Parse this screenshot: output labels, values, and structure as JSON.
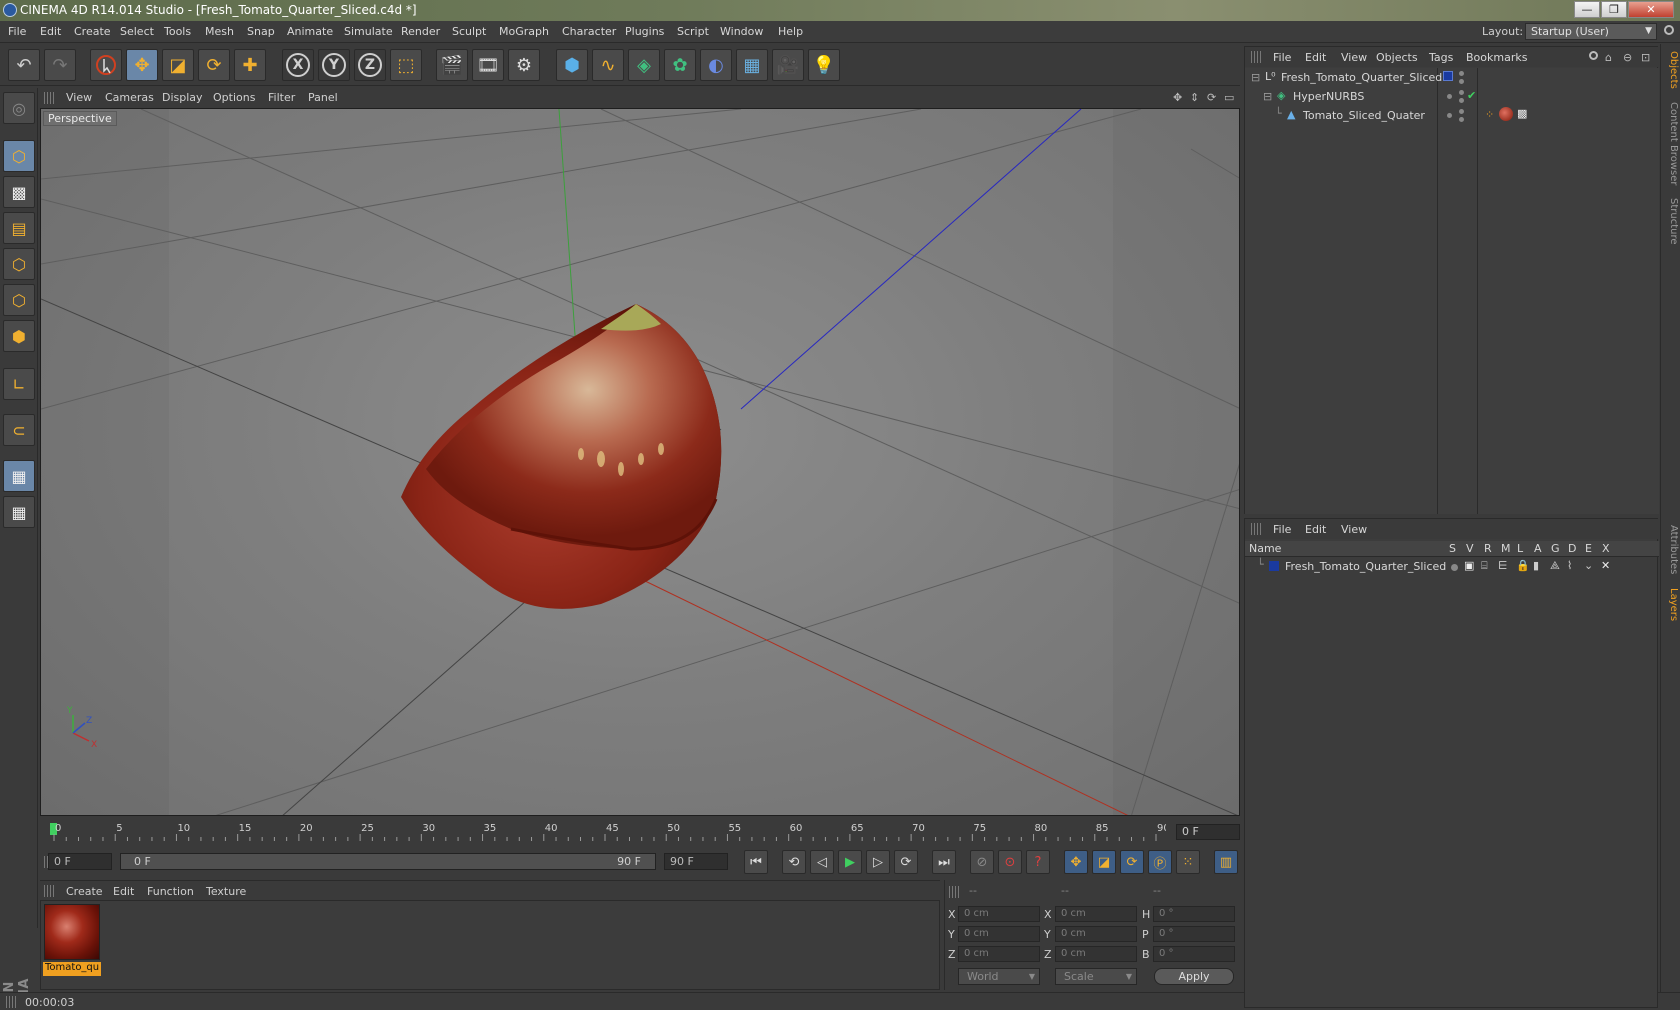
{
  "window": {
    "title": "CINEMA 4D R14.014 Studio - [Fresh_Tomato_Quarter_Sliced.c4d *]",
    "controls": [
      "—",
      "❐",
      "✕"
    ]
  },
  "menubar": {
    "items": [
      "File",
      "Edit",
      "Create",
      "Select",
      "Tools",
      "Mesh",
      "Snap",
      "Animate",
      "Simulate",
      "Render",
      "Sculpt",
      "MoGraph",
      "Character",
      "Plugins",
      "Script",
      "Window",
      "Help"
    ],
    "layout_label": "Layout:",
    "layout_value": "Startup (User)"
  },
  "toolbar": {
    "icons": [
      "undo-icon",
      "redo-icon",
      "live-selection-icon",
      "move-icon",
      "scale-icon",
      "rotate-icon",
      "add-icon",
      "x-axis-lock-icon",
      "y-axis-lock-icon",
      "z-axis-lock-icon",
      "coordinate-system-icon",
      "render-view-icon",
      "render-picture-viewer-icon",
      "render-settings-icon",
      "cube-icon",
      "spline-icon",
      "nurbs-icon",
      "array-icon",
      "deformer-icon",
      "floor-icon",
      "camera-icon",
      "light-icon"
    ],
    "xyz": [
      "X",
      "Y",
      "Z"
    ]
  },
  "viewport": {
    "menu": [
      "View",
      "Cameras",
      "Display",
      "Options",
      "Filter",
      "Panel"
    ],
    "label": "Perspective",
    "axis": {
      "x": "X",
      "y": "Y",
      "z": "Z"
    }
  },
  "timeline": {
    "ticks": [
      "0",
      "5",
      "10",
      "15",
      "20",
      "25",
      "30",
      "35",
      "40",
      "45",
      "50",
      "55",
      "60",
      "65",
      "70",
      "75",
      "80",
      "85",
      "90"
    ],
    "current_frame": "0 F",
    "start_field": "0 F",
    "range_start": "0 F",
    "range_end": "90 F",
    "end_field": "90 F"
  },
  "material_manager": {
    "menu": [
      "Create",
      "Edit",
      "Function",
      "Texture"
    ],
    "materials": [
      {
        "name": "Tomato_qu"
      }
    ]
  },
  "coordinates": {
    "headers": [
      "--",
      "--",
      "--"
    ],
    "rows": [
      {
        "l1": "X",
        "v1": "0 cm",
        "l2": "X",
        "v2": "0 cm",
        "l3": "H",
        "v3": "0 °"
      },
      {
        "l1": "Y",
        "v1": "0 cm",
        "l2": "Y",
        "v2": "0 cm",
        "l3": "P",
        "v3": "0 °"
      },
      {
        "l1": "Z",
        "v1": "0 cm",
        "l2": "Z",
        "v2": "0 cm",
        "l3": "B",
        "v3": "0 °"
      }
    ],
    "mode": "World",
    "transform": "Scale",
    "apply": "Apply"
  },
  "object_manager": {
    "menu": [
      "File",
      "Edit",
      "View",
      "Objects",
      "Tags",
      "Bookmarks"
    ],
    "objects": [
      {
        "name": "Fresh_Tomato_Quarter_Sliced"
      },
      {
        "name": "HyperNURBS"
      },
      {
        "name": "Tomato_Sliced_Quater"
      }
    ]
  },
  "layer_manager": {
    "menu": [
      "File",
      "Edit",
      "View"
    ],
    "columns": [
      "Name",
      "S",
      "V",
      "R",
      "M",
      "L",
      "A",
      "G",
      "D",
      "E",
      "X"
    ],
    "layers": [
      {
        "name": "Fresh_Tomato_Quarter_Sliced",
        "color": "#1a3aa0"
      }
    ]
  },
  "side_tabs": [
    "Objects",
    "Content Browser",
    "Structure",
    "Attributes",
    "Layers"
  ],
  "status": {
    "text": "00:00:03"
  },
  "colors": {
    "accent": "#f0a020",
    "selection": "#6a87a8",
    "tomato": "#9a2a18"
  }
}
